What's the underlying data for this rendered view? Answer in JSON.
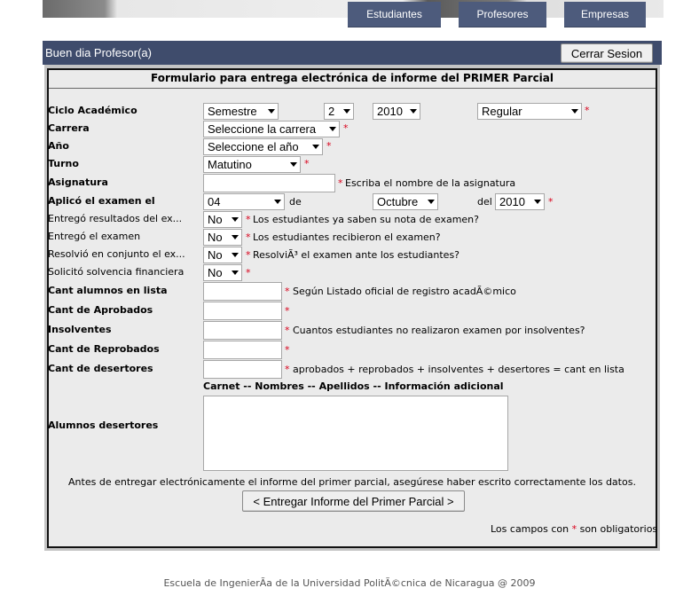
{
  "nav": {
    "tabs": [
      {
        "label": "Estudiantes"
      },
      {
        "label": "Profesores"
      },
      {
        "label": "Empresas"
      }
    ]
  },
  "header": {
    "greeting": "Buen dia Profesor(a)",
    "logout_label": "Cerrar Sesion"
  },
  "form": {
    "title": "Formulario para entrega electrónica de informe del PRIMER Parcial",
    "required_mark": "*",
    "fields": {
      "ciclo": {
        "label": "Ciclo Académico",
        "periodo": "Semestre",
        "numero": "2",
        "anio": "2010",
        "tipo": "Regular"
      },
      "carrera": {
        "label": "Carrera",
        "value": "Seleccione la carrera"
      },
      "anio": {
        "label": "Año",
        "value": "Seleccione el año"
      },
      "turno": {
        "label": "Turno",
        "value": "Matutino"
      },
      "asignatura": {
        "label": "Asignatura",
        "value": "",
        "note": "Escriba el nombre de la asignatura"
      },
      "examen": {
        "label": "Aplicó el examen el",
        "dia": "04",
        "de": "de",
        "mes": "Octubre",
        "del": "del",
        "anio": "2010"
      },
      "resultados": {
        "label": "Entregó resultados del ex...",
        "value": "No",
        "note": "Los estudiantes ya saben su nota de examen?"
      },
      "entrego": {
        "label": "Entregó el examen",
        "value": "No",
        "note": "Los estudiantes recibieron el examen?"
      },
      "resolvio": {
        "label": "Resolvió en conjunto el ex...",
        "value": "No",
        "note": "ResolviÃ³ el examen ante los estudiantes?"
      },
      "solvencia": {
        "label": "Solicitó solvencia financiera",
        "value": "No"
      },
      "alumnos": {
        "label": "Cant alumnos en lista",
        "value": "",
        "note": "Según Listado oficial de registro acadÃ©mico"
      },
      "aprobados": {
        "label": "Cant de Aprobados",
        "value": ""
      },
      "insolventes": {
        "label": "Insolventes",
        "value": "",
        "note": "Cuantos estudiantes no realizaron examen por insolventes?"
      },
      "reprobados": {
        "label": "Cant de Reprobados",
        "value": ""
      },
      "desertores": {
        "label": "Cant de desertores",
        "value": "",
        "note": "aprobados + reprobados + insolventes + desertores = cant en lista"
      }
    },
    "desertores_list": {
      "header": "Carnet -- Nombres -- Apellidos -- Información adicional",
      "label": "Alumnos desertores",
      "value": ""
    },
    "warning": "Antes de entregar electrónicamente el informe del primer parcial, asegúrese haber escrito correctamente los datos.",
    "submit_label": "< Entregar Informe del Primer Parcial >",
    "legal_before": "Los campos con",
    "legal_after": "son obligatorios"
  },
  "footer": {
    "text": "Escuela de IngenierÃ­a de la Universidad PolitÃ©cnica de Nicaragua @ 2009"
  },
  "colors": {
    "nav_bg": "#4d5b7c",
    "header_bg": "#3f4c6c",
    "required": "#d9001b",
    "form_bg": "#ebebeb"
  }
}
